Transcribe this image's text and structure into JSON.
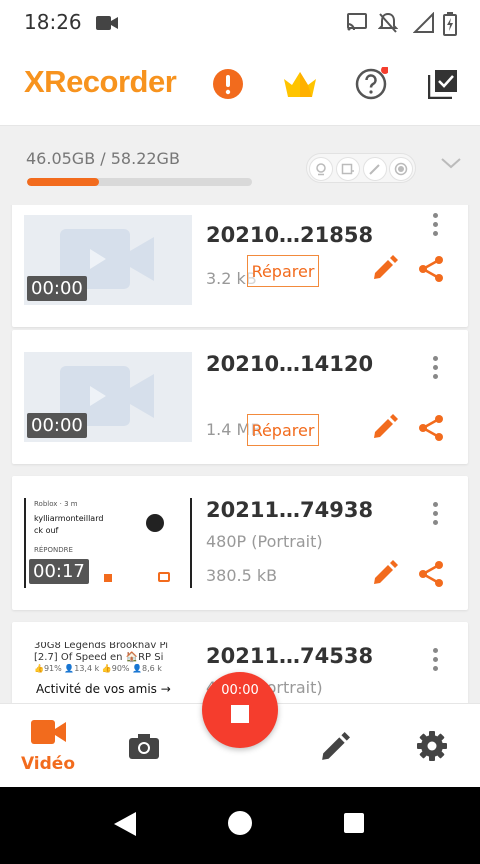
{
  "status_bar": {
    "time": "18:26",
    "icons": [
      "video-record-icon",
      "cast-icon",
      "notifications-off-icon",
      "signal-icon",
      "battery-charging-icon"
    ]
  },
  "header": {
    "logo": "XRecorder",
    "brand_color": "#f7931e",
    "icons": [
      "alert-icon",
      "premium-crown-icon",
      "help-icon",
      "select-all-icon"
    ]
  },
  "storage": {
    "text": "46.05GB / 58.22GB",
    "used_fraction": 0.32,
    "filters": [
      "camera-filter-icon",
      "screen-filter-icon",
      "brush-filter-icon",
      "record-filter-icon"
    ]
  },
  "videos": [
    {
      "name": "20210…21858",
      "duration": "00:00",
      "size": "3.2 kB",
      "repair_label": "Réparer"
    },
    {
      "name": "20210…14120",
      "duration": "00:00",
      "size": "1.4 MB",
      "repair_label": "Réparer"
    },
    {
      "name": "20211…74938",
      "duration": "00:17",
      "resolution": "480P (Portrait)",
      "size": "380.5 kB",
      "thumb": {
        "source": "Roblox · 3 m",
        "user_line1": "kylliarmonteillard",
        "user_line2": "ck ouf",
        "reply": "RÉPONDRE"
      }
    },
    {
      "name": "20211…74538",
      "resolution": "480P (Portrait)",
      "thumb": {
        "line1": "30G8   Legends   Brookhav   Pi",
        "line2": "[2.7]  Of Speed  en 🏠RP   Si",
        "stats": "👍91% 👤13,4 k  👍90% 👤8,6 k",
        "activity": "Activité de vos amis →"
      }
    }
  ],
  "bottom_nav": {
    "video_label": "Vidéo",
    "active_color": "#f26b1d",
    "record_timer": "00:00",
    "record_color": "#f53d2d"
  }
}
